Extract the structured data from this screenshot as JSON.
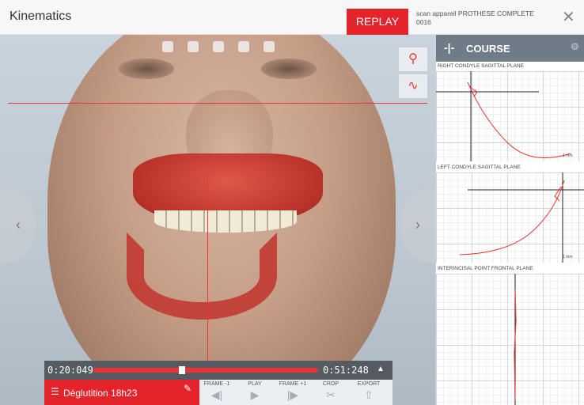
{
  "header": {
    "title": "Kinematics",
    "replay_label": "REPLAY",
    "scan_name": "scan appareil PROTHESE COMPLETE 0016",
    "close_icon": "close-icon"
  },
  "player": {
    "time_start": "0:20:049",
    "time_end": "0:51:248",
    "progress": 0.38,
    "sequence_label": "Déglutition 18h23",
    "controls": [
      {
        "label": "FRAME -1",
        "icon": "step-back-icon"
      },
      {
        "label": "PLAY",
        "icon": "play-icon"
      },
      {
        "label": "FRAME +1",
        "icon": "step-forward-icon"
      },
      {
        "label": "CROP",
        "icon": "scissors-icon"
      },
      {
        "label": "EXPORT",
        "icon": "export-icon"
      }
    ]
  },
  "panel": {
    "title": "COURSE",
    "graphs": [
      {
        "label": "RIGHT CONDYLE SAGITTAL PLANE",
        "scale": "1 mm"
      },
      {
        "label": "LEFT CONDYLE SAGITTAL PLANE",
        "scale": "1 mm"
      },
      {
        "label": "INTERINCISAL POINT FRONTAL PLANE",
        "scale": ""
      }
    ]
  },
  "colors": {
    "accent": "#e5232a",
    "panel_header": "#6f7b86",
    "player_bar": "#555b61"
  }
}
